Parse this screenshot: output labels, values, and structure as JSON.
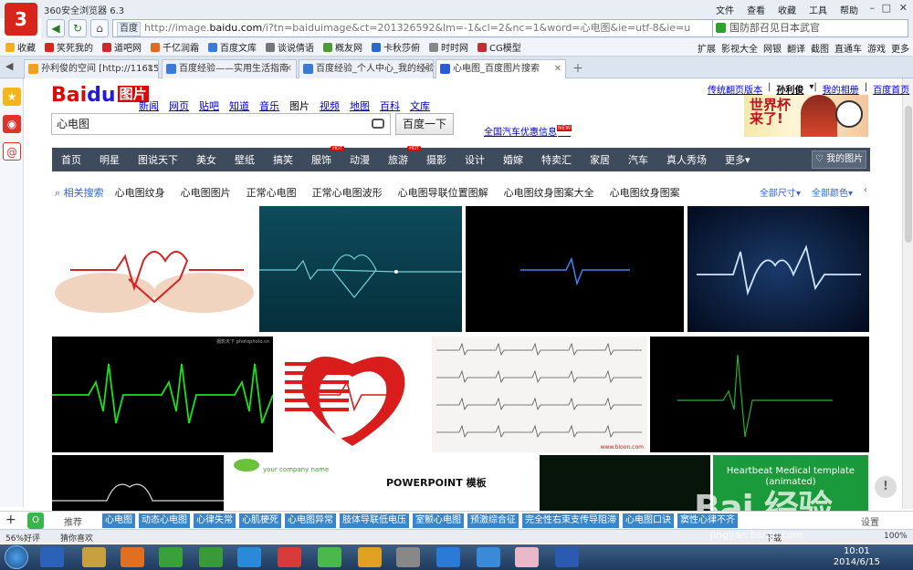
{
  "browser": {
    "title": "360安全浏览器 6.3",
    "menus": [
      "文件",
      "查看",
      "收藏",
      "工具",
      "帮助"
    ],
    "address": {
      "badge": "百度",
      "url_prefix": "http://image.",
      "url_domain": "baidu.com",
      "url_rest": "/i?tn=baiduimage&ct=201326592&lm=-1&cl=2&nc=1&word=心电图&ie=utf-8&ie=u"
    },
    "search_box": "国防部召见日本武官",
    "favorites": [
      "收藏",
      "笑死我的",
      "道吧网",
      "千亿润霜",
      "百度文库",
      "谈说倩语",
      "概友网",
      "卡秋莎俯",
      "时时网",
      "CG模型"
    ],
    "favorites_right": [
      "扩展",
      "影视大全",
      "网银",
      "翻译",
      "截图",
      "直通车",
      "游戏",
      "更多"
    ],
    "tabs": [
      {
        "label": "孙利俊的空间 [http://116158",
        "color": "#f0a020"
      },
      {
        "label": "百度经验——实用生活指南",
        "color": "#3a7bd5"
      },
      {
        "label": "百度经验_个人中心_我的经验",
        "color": "#3a7bd5"
      },
      {
        "label": "心电图_百度图片搜索",
        "color": "#2a5bd5"
      }
    ]
  },
  "baidu": {
    "logo_bai": "Bai",
    "logo_du": "du",
    "logo_pic": "图片",
    "nav": [
      "新闻",
      "网页",
      "贴吧",
      "知道",
      "音乐",
      "图片",
      "视频",
      "地图",
      "百科",
      "文库"
    ],
    "nav_current": 5,
    "top_links": [
      "传统翻页版本",
      "孙利俊",
      "我的相册",
      "百度首页"
    ],
    "query": "心电图",
    "search_button": "百度一下",
    "ad_link": "全国汽车优惠信息",
    "ad_new": "NEW",
    "banner_text": "世界杯来了!",
    "categories": [
      "首页",
      "明星",
      "图说天下",
      "美女",
      "壁纸",
      "搞笑",
      "服饰",
      "动漫",
      "旅游",
      "摄影",
      "设计",
      "婚嫁",
      "特卖汇",
      "家居",
      "汽车",
      "真人秀场",
      "更多"
    ],
    "hot_label": "HOT",
    "my_pics": "我的图片",
    "related_label": "相关搜索",
    "related": [
      "心电图纹身",
      "心电图图片",
      "正常心电图",
      "正常心电图波形",
      "心电图导联位置图解",
      "心电图纹身图案大全",
      "心电图纹身图案"
    ],
    "filters": [
      "全部尺寸",
      "全部颜色"
    ],
    "image_texts": {
      "img6_caption": "摄影天下 photophoto.cn",
      "img7_watermark": "www.bioon.com",
      "img10_company": "your company name",
      "img10_title": "POWERPOINT 模板",
      "img12_title": "Heartbeat Medical template",
      "img12_sub": "(animated)"
    }
  },
  "bottom": {
    "recommend": "推荐",
    "tags": [
      "心电图",
      "动态心电图",
      "心律失常",
      "心肌梗死",
      "心电图异常",
      "肢体导联低电压",
      "室颤心电图",
      "预激综合征",
      "完全性右束支传导阻滞",
      "心电图口诀",
      "窦性心律不齐"
    ],
    "settings": "设置",
    "status_left": "56%好评",
    "status_mid": "猜你喜欢",
    "status_zoom": "100%",
    "status_down": "下载"
  },
  "watermark": {
    "text": "Bai 经验",
    "sub": "jingyan.baidu.com"
  },
  "taskbar": {
    "time": "10:01",
    "date": "2014/6/15"
  },
  "colors": {
    "baidu_red": "#e10602",
    "baidu_blue": "#2319dc",
    "category_bar": "#3d4b5c",
    "tag_blue": "#3a86c8",
    "ecg_green": "#19e21a",
    "ecg_blue": "#3d86f5"
  }
}
